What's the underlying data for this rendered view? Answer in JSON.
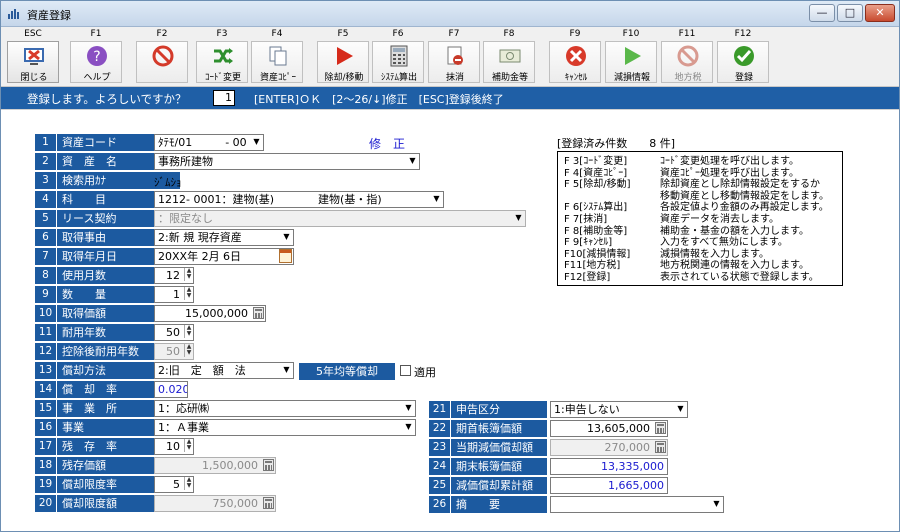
{
  "window": {
    "title": "資産登録",
    "minimize": "—",
    "restore": "□",
    "close": "✕"
  },
  "toolbar": [
    {
      "key": "ESC",
      "label": "閉じる",
      "icon": "close-screen-icon",
      "color": "#d83a2a",
      "disabled": false
    },
    {
      "key": "F1",
      "label": "ヘルプ",
      "icon": "help-icon",
      "color": "#8a4fc2",
      "disabled": false
    },
    {
      "key": "F2",
      "label": "",
      "icon": "prohibit-icon",
      "color": "#d43a2a",
      "disabled": false
    },
    {
      "key": "F3",
      "label": "ｺｰﾄﾞ変更",
      "icon": "shuffle-icon",
      "color": "#2e8f2e",
      "disabled": false
    },
    {
      "key": "F4",
      "label": "資産ｺﾋﾟｰ",
      "icon": "copy-icon",
      "color": "#6a7a90",
      "disabled": false
    },
    {
      "key": "F5",
      "label": "除却/移動",
      "icon": "play-icon",
      "color": "#d62a1a",
      "disabled": false
    },
    {
      "key": "F6",
      "label": "ｼｽﾃﾑ算出",
      "icon": "calculator-icon",
      "color": "#555555",
      "disabled": false
    },
    {
      "key": "F7",
      "label": "抹消",
      "icon": "erase-icon",
      "color": "#c83a2a",
      "disabled": false
    },
    {
      "key": "F8",
      "label": "補助金等",
      "icon": "money-icon",
      "color": "#7a8a70",
      "disabled": false
    },
    {
      "key": "F9",
      "label": "ｷｬﾝｾﾙ",
      "icon": "cancel-icon",
      "color": "#d83a2a",
      "disabled": false
    },
    {
      "key": "F10",
      "label": "減損情報",
      "icon": "play-green-icon",
      "color": "#5ab84a",
      "disabled": false
    },
    {
      "key": "F11",
      "label": "地方税",
      "icon": "prohibit-gray-icon",
      "color": "#d89a90",
      "disabled": true
    },
    {
      "key": "F12",
      "label": "登録",
      "icon": "check-icon",
      "color": "#3a9a2a",
      "disabled": false
    }
  ],
  "message": {
    "text": "登録します。よろしいですか？",
    "input_value": "1",
    "keys": "[ENTER]ＯＫ　[2～26/↓]修正　[ESC]登録後終了"
  },
  "mode_label": "修　正",
  "fields_left": [
    {
      "no": "1",
      "label": "資産コード",
      "value": "ﾀﾃﾓ/01　　　- 00",
      "ctrl": "dropdown"
    },
    {
      "no": "2",
      "label": "資　産　名",
      "value": "事務所建物",
      "ctrl": "dropdown"
    },
    {
      "no": "3",
      "label": "検索用ｶﾅ",
      "value": "ｼﾞﾑｼｮ",
      "ctrl": "plain"
    },
    {
      "no": "4",
      "label": "科　　目",
      "value": "1212- 0001：建物(基)　　　　建物(基・指)",
      "ctrl": "dropdown"
    },
    {
      "no": "5",
      "label": "リース契約",
      "value": "：限定なし",
      "ctrl": "dropdown-gray"
    },
    {
      "no": "6",
      "label": "取得事由",
      "value": "2:新 規 現存資産",
      "ctrl": "dropdown"
    },
    {
      "no": "7",
      "label": "取得年月日",
      "value": "20XX年 2月 6日",
      "ctrl": "calendar"
    },
    {
      "no": "8",
      "label": "使用月数",
      "value": "12",
      "ctrl": "spin"
    },
    {
      "no": "9",
      "label": "数　　量",
      "value": "1",
      "ctrl": "spin"
    },
    {
      "no": "10",
      "label": "取得価額",
      "value": "15,000,000",
      "ctrl": "calc"
    },
    {
      "no": "11",
      "label": "耐用年数",
      "value": "50",
      "ctrl": "spin"
    },
    {
      "no": "12",
      "label": "控除後耐用年数",
      "value": "50",
      "ctrl": "spin-gray"
    },
    {
      "no": "13",
      "label": "償却方法",
      "value": "2:旧　定　額　法",
      "ctrl": "dropdown"
    },
    {
      "no": "14",
      "label": "償　却　率",
      "value": "0.020",
      "ctrl": "blue"
    },
    {
      "no": "15",
      "label": "事　業　所",
      "value": "1：応研㈱",
      "ctrl": "dropdown"
    },
    {
      "no": "16",
      "label": "事業",
      "value": "1：Ａ事業",
      "ctrl": "dropdown"
    },
    {
      "no": "17",
      "label": "残　存　率",
      "value": "10",
      "ctrl": "spin"
    },
    {
      "no": "18",
      "label": "残存価額",
      "value": "1,500,000",
      "ctrl": "calc-gray"
    },
    {
      "no": "19",
      "label": "償却限度率",
      "value": "5",
      "ctrl": "spin"
    },
    {
      "no": "20",
      "label": "償却限度額",
      "value": "750,000",
      "ctrl": "calc-gray"
    }
  ],
  "fields_right": [
    {
      "no": "21",
      "label": "申告区分",
      "value": "1:申告しない",
      "ctrl": "dropdown"
    },
    {
      "no": "22",
      "label": "期首帳簿価額",
      "value": "13,605,000",
      "ctrl": "calc"
    },
    {
      "no": "23",
      "label": "当期減価償却額",
      "value": "270,000",
      "ctrl": "calc-gray"
    },
    {
      "no": "24",
      "label": "期末帳簿価額",
      "value": "13,335,000",
      "ctrl": "blue-right"
    },
    {
      "no": "25",
      "label": "減価償却累計額",
      "value": "1,665,000",
      "ctrl": "blue-right"
    },
    {
      "no": "26",
      "label": "摘　　要",
      "value": "",
      "ctrl": "dropdown"
    }
  ],
  "five_year": {
    "button": "5年均等償却",
    "checkbox_label": "適用"
  },
  "info": {
    "title": "[登録済み件数　　8 件]",
    "lines": [
      {
        "k": "F 3[ｺｰﾄﾞ変更]",
        "d": "ｺｰﾄﾞ変更処理を呼び出します。"
      },
      {
        "k": "F 4[資産ｺﾋﾟｰ]",
        "d": "資産ｺﾋﾟｰ処理を呼び出します。"
      },
      {
        "k": "F 5[除却/移動]",
        "d": "除却資産とし除却情報設定をするか"
      },
      {
        "k": "",
        "d": "移動資産とし移動情報設定をします。"
      },
      {
        "k": "F 6[ｼｽﾃﾑ算出]",
        "d": "各設定値より金額のみ再設定します。"
      },
      {
        "k": "F 7[抹消]",
        "d": "資産データを消去します。"
      },
      {
        "k": "F 8[補助金等]",
        "d": "補助金・基金の額を入力します。"
      },
      {
        "k": "F 9[ｷｬﾝｾﾙ]",
        "d": "入力をすべて無効にします。"
      },
      {
        "k": "F10[減損情報]",
        "d": "減損情報を入力します。"
      },
      {
        "k": "F11[地方税]",
        "d": "地方税関連の情報を入力します。"
      },
      {
        "k": "F12[登録]",
        "d": "表示されている状態で登録します。"
      }
    ]
  }
}
